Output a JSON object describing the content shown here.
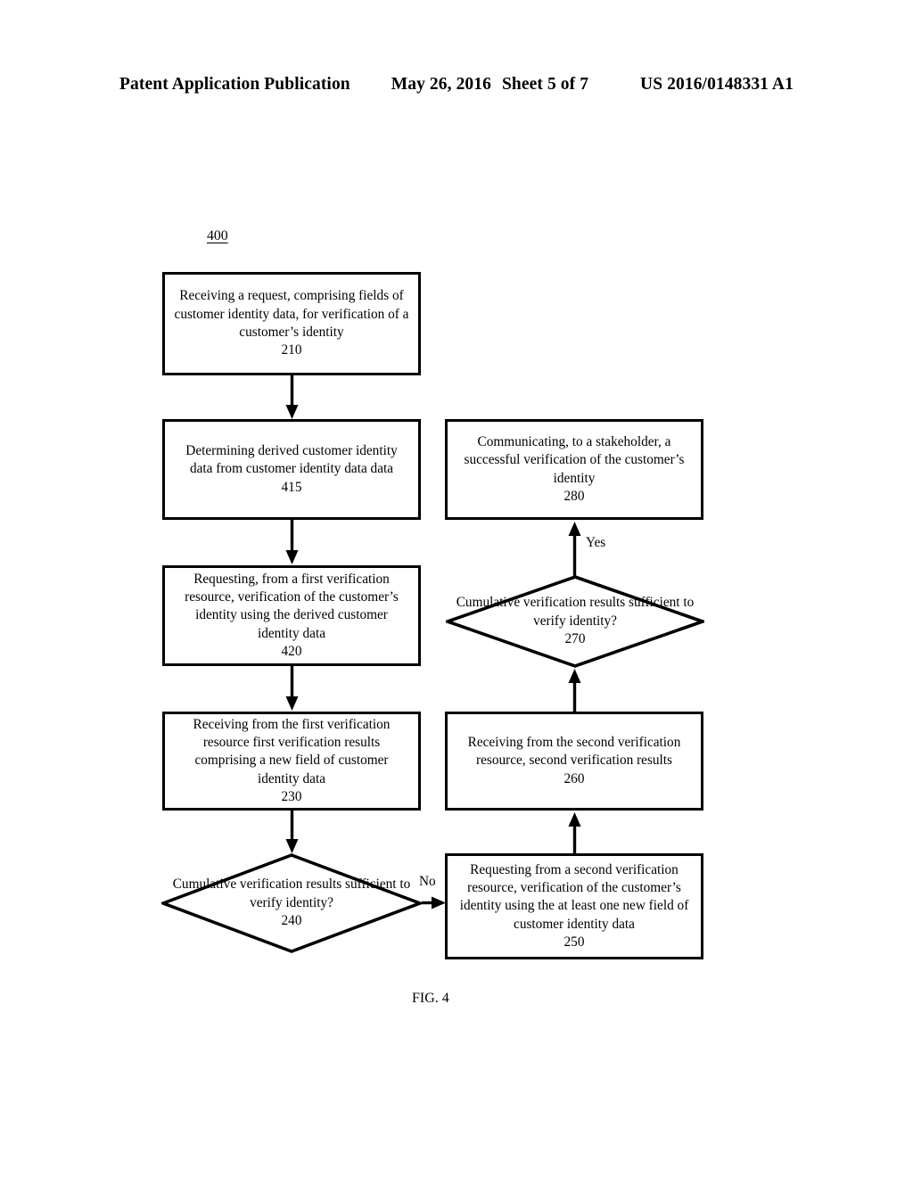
{
  "header": {
    "left": "Patent Application Publication",
    "date": "May 26, 2016",
    "sheet": "Sheet 5 of 7",
    "number": "US 2016/0148331 A1"
  },
  "figure": {
    "reference_numeral": "400",
    "caption": "FIG. 4"
  },
  "nodes": {
    "n210": {
      "text": "Receiving a request, comprising fields of customer identity data, for verification of a customer’s identity",
      "number": "210"
    },
    "n415": {
      "text": "Determining derived customer identity data from customer identity data data",
      "number": "415"
    },
    "n420": {
      "text": "Requesting, from a first verification resource, verification of the customer’s identity using the derived customer identity data",
      "number": "420"
    },
    "n230": {
      "text": "Receiving from the first verification resource first verification results comprising a new field of customer identity data",
      "number": "230"
    },
    "n240": {
      "text": "Cumulative verification results sufficient to verify identity?",
      "number": "240"
    },
    "n250": {
      "text": "Requesting from a second verification resource, verification of the customer’s identity using the at least one new field of customer identity data",
      "number": "250"
    },
    "n260": {
      "text": "Receiving from the second verification resource, second verification results",
      "number": "260"
    },
    "n270": {
      "text": "Cumulative verification results sufficient to verify identity?",
      "number": "270"
    },
    "n280": {
      "text": "Communicating, to a stakeholder, a successful verification of the customer’s identity",
      "number": "280"
    }
  },
  "edges": {
    "no_label": "No",
    "yes_label": "Yes"
  },
  "colors": {
    "ink": "#000000",
    "paper": "#ffffff"
  }
}
